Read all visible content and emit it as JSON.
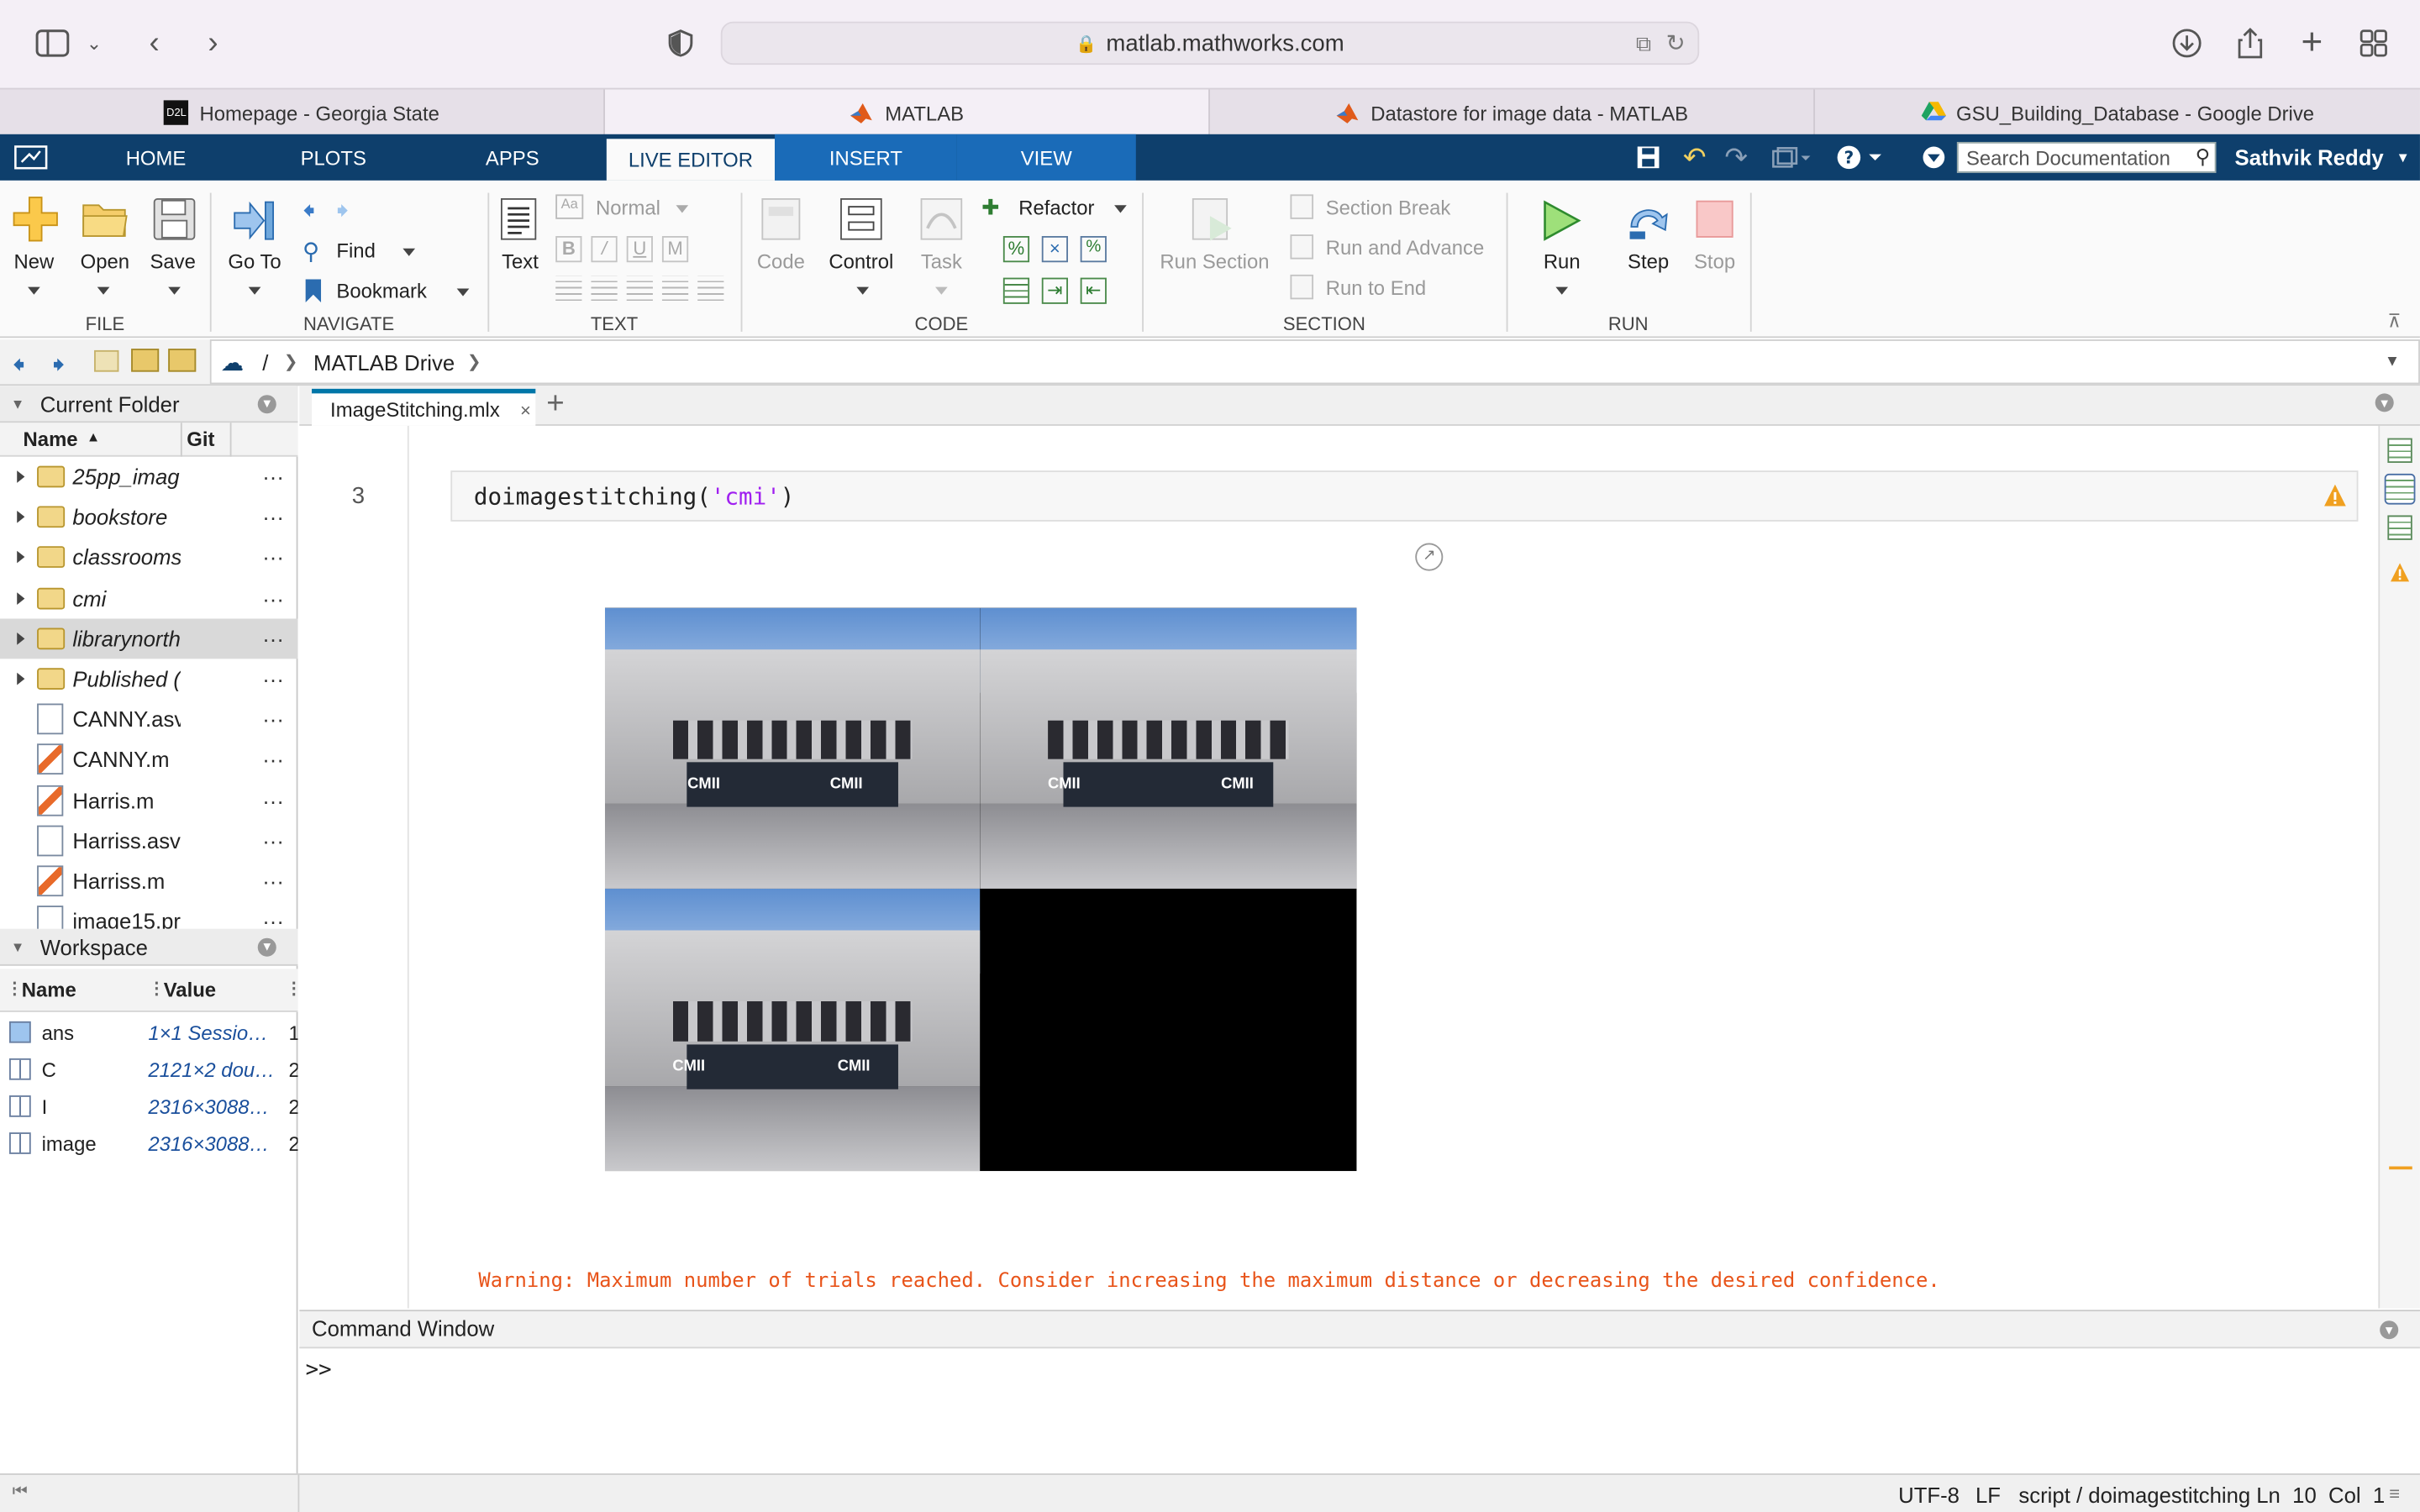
{
  "browser": {
    "url": "matlab.mathworks.com",
    "tabs": [
      {
        "label": "Homepage - Georgia State",
        "favicon": "D2L"
      },
      {
        "label": "MATLAB"
      },
      {
        "label": "Datastore for image data - MATLAB"
      },
      {
        "label": "GSU_Building_Database - Google Drive"
      }
    ]
  },
  "toolstrip": {
    "tabs": [
      "HOME",
      "PLOTS",
      "APPS",
      "LIVE EDITOR",
      "INSERT",
      "VIEW"
    ],
    "search_placeholder": "Search Documentation",
    "user": "Sathvik Reddy"
  },
  "ribbon": {
    "file": {
      "new": "New",
      "open": "Open",
      "save": "Save",
      "section": "FILE"
    },
    "navigate": {
      "goto": "Go To",
      "find": "Find",
      "bookmark": "Bookmark",
      "section": "NAVIGATE"
    },
    "text": {
      "text": "Text",
      "style": "Normal",
      "section": "TEXT"
    },
    "code": {
      "code": "Code",
      "control": "Control",
      "task": "Task",
      "refactor": "Refactor",
      "section": "CODE"
    },
    "sectiongroup": {
      "run_section": "Run Section",
      "section_break": "Section Break",
      "run_and_advance": "Run and Advance",
      "run_to_end": "Run to End",
      "section": "SECTION"
    },
    "run": {
      "run": "Run",
      "step": "Step",
      "stop": "Stop",
      "section": "RUN"
    }
  },
  "address": {
    "root": "/",
    "folder": "MATLAB Drive"
  },
  "current_folder": {
    "title": "Current Folder",
    "col_name": "Name",
    "col_git": "Git",
    "items": [
      {
        "name": "25pp_imag",
        "type": "folder"
      },
      {
        "name": "bookstore",
        "type": "folder"
      },
      {
        "name": "classrooms",
        "type": "folder"
      },
      {
        "name": "cmi",
        "type": "folder"
      },
      {
        "name": "librarynorth",
        "type": "folder"
      },
      {
        "name": "Published (",
        "type": "folder"
      },
      {
        "name": "CANNY.asv",
        "type": "file"
      },
      {
        "name": "CANNY.m",
        "type": "mfile"
      },
      {
        "name": "Harris.m",
        "type": "mfile"
      },
      {
        "name": "Harriss.asv",
        "type": "file"
      },
      {
        "name": "Harriss.m",
        "type": "mfile"
      },
      {
        "name": "image15.pr",
        "type": "file"
      }
    ]
  },
  "workspace": {
    "title": "Workspace",
    "col_name": "Name",
    "col_value": "Value",
    "vars": [
      {
        "name": "ans",
        "value": "1×1 Sessio…",
        "extra": "1"
      },
      {
        "name": "C",
        "value": "2121×2 dou…",
        "extra": "2"
      },
      {
        "name": "I",
        "value": "2316×3088…",
        "extra": "2"
      },
      {
        "name": "image",
        "value": "2316×3088…",
        "extra": "2"
      }
    ]
  },
  "editor": {
    "tab": "ImageStitching.mlx",
    "line_number": "3",
    "code_fn": "doimagestitching(",
    "code_arg": "'cmi'",
    "code_close": ")",
    "image_label": "CMII",
    "warning": "Warning: Maximum number of trials reached. Consider increasing the maximum distance or decreasing the desired confidence."
  },
  "command_window": {
    "title": "Command Window",
    "prompt": ">>"
  },
  "status": {
    "encoding": "UTF-8",
    "eol": "LF",
    "context": "script / doimagestitching",
    "position": "Ln  10  Col  1"
  }
}
